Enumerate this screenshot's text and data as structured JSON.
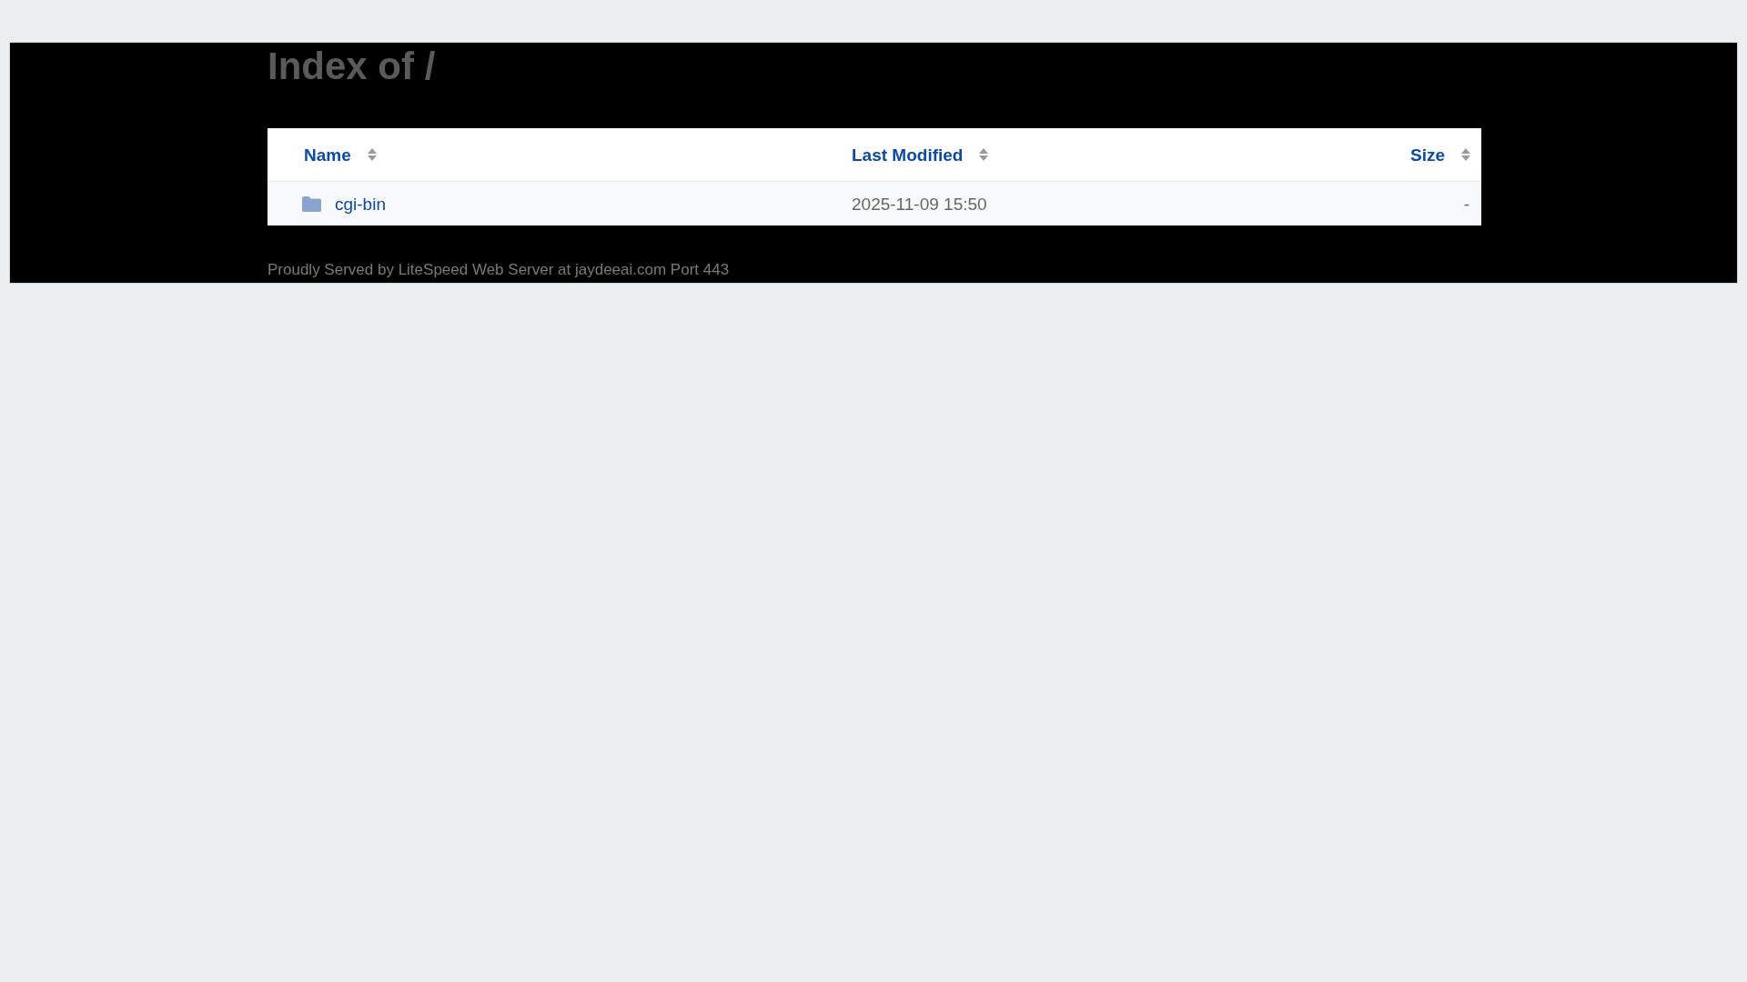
{
  "page_title": "Index of /",
  "table": {
    "columns": [
      {
        "label": "Name"
      },
      {
        "label": "Last Modified"
      },
      {
        "label": "Size"
      }
    ],
    "rows": [
      {
        "kind": "folder",
        "name": "cgi-bin",
        "last_modified": "2025-11-09 15:50",
        "size": "-"
      }
    ]
  },
  "footer": "Proudly Served by LiteSpeed Web Server at jaydeeai.com Port 443"
}
